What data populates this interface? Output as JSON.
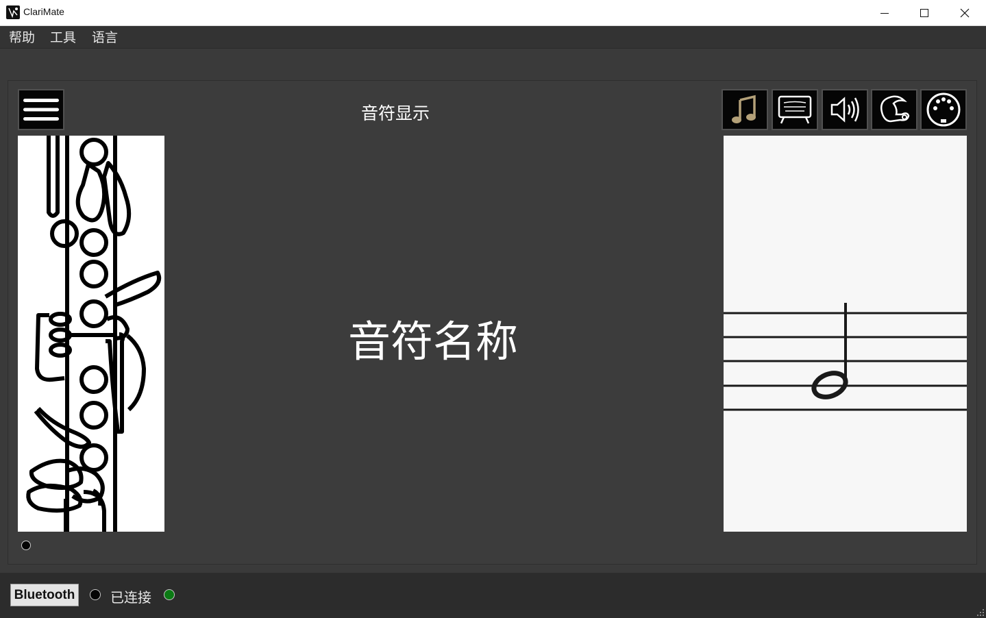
{
  "window": {
    "title": "ClariMate",
    "controls": [
      "minimize-icon",
      "maximize-icon",
      "close-icon"
    ]
  },
  "menubar": {
    "items": [
      {
        "label": "帮助"
      },
      {
        "label": "工具"
      },
      {
        "label": "语言"
      }
    ]
  },
  "panel": {
    "title": "音符显示",
    "note_name": "音符名称",
    "menu_icon": "hamburger-icon",
    "toolbar_icons": [
      "music-note-icon",
      "tuner-display-icon",
      "speaker-icon",
      "player-head-icon",
      "midi-connector-icon"
    ]
  },
  "footer": {
    "bluetooth_label": "Bluetooth",
    "status_label": "已连接"
  },
  "colors": {
    "background": "#3a3a3a",
    "panel": "#3c3c3c",
    "note_icon": "#b3a078",
    "connected": "#0b7a14"
  }
}
